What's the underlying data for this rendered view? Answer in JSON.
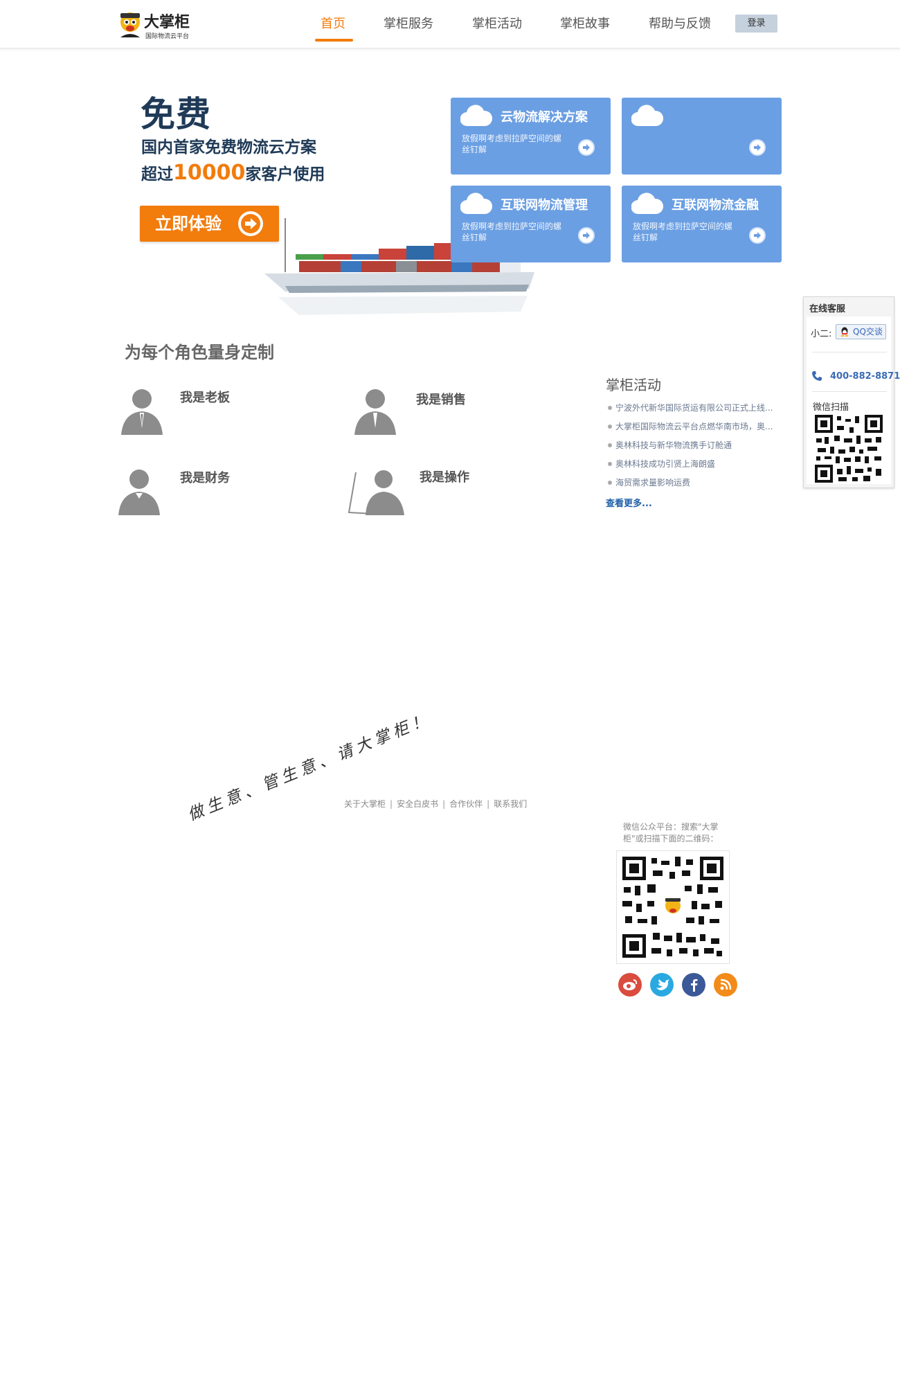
{
  "header": {
    "logo_name": "大掌柜",
    "logo_sub": "国际物流云平台",
    "nav": [
      {
        "label": "首页",
        "active": true
      },
      {
        "label": "掌柜服务",
        "active": false
      },
      {
        "label": "掌柜活动",
        "active": false
      },
      {
        "label": "掌柜故事",
        "active": false
      },
      {
        "label": "帮助与反馈",
        "active": false
      }
    ],
    "login_label": "登录"
  },
  "hero": {
    "headline": "免费",
    "line1": "国内首家免费物流云方案",
    "line2_prefix": "超过",
    "line2_count": "10000",
    "line2_suffix": "家客户使用",
    "cta_label": "立即体验"
  },
  "cards": [
    {
      "title": "云物流解决方案",
      "desc": "放假啊考虑到拉萨空间的螺丝钉解"
    },
    {
      "title": "",
      "desc": ""
    },
    {
      "title": "互联网物流管理",
      "desc": "放假啊考虑到拉萨空间的螺丝钉解"
    },
    {
      "title": "互联网物流金融",
      "desc": "放假啊考虑到拉萨空间的螺丝钉解"
    }
  ],
  "roles": {
    "title": "为每个角色量身定制",
    "items": [
      {
        "label": "我是老板",
        "icon": "boss-icon"
      },
      {
        "label": "我是销售",
        "icon": "sales-icon"
      },
      {
        "label": "我是财务",
        "icon": "finance-icon"
      },
      {
        "label": "我是操作",
        "icon": "operator-icon"
      }
    ]
  },
  "activities": {
    "title": "掌柜活动",
    "items": [
      "宁波外代新华国际货运有限公司正式上线...",
      "大掌柜国际物流云平台点燃华南市场，奥...",
      "奥林科技与新华物流携手订舱通",
      "奥林科技成功引贤上海朗盛",
      "海贸需求量影响运费"
    ],
    "more_label": "查看更多..."
  },
  "service": {
    "title": "在线客服",
    "xiaoer_label": "小二:",
    "qq_label": "QQ交谈",
    "phone": "400-882-8871",
    "wechat_label": "微信扫描"
  },
  "footer": {
    "slogan": "做生意、管生意、请大掌柜！",
    "links": [
      "关于大掌柜",
      "安全白皮书",
      "合作伙伴",
      "联系我们"
    ],
    "wechat_text": "微信公众平台：搜索\"大掌柜\"或扫描下面的二维码：",
    "social": [
      "weibo-icon",
      "twitter-icon",
      "facebook-icon",
      "rss-icon"
    ]
  },
  "colors": {
    "accent": "#f27c0c",
    "card_blue": "#6b9fe3",
    "heading_navy": "#1f3a57",
    "link_blue": "#1f5fa8"
  }
}
